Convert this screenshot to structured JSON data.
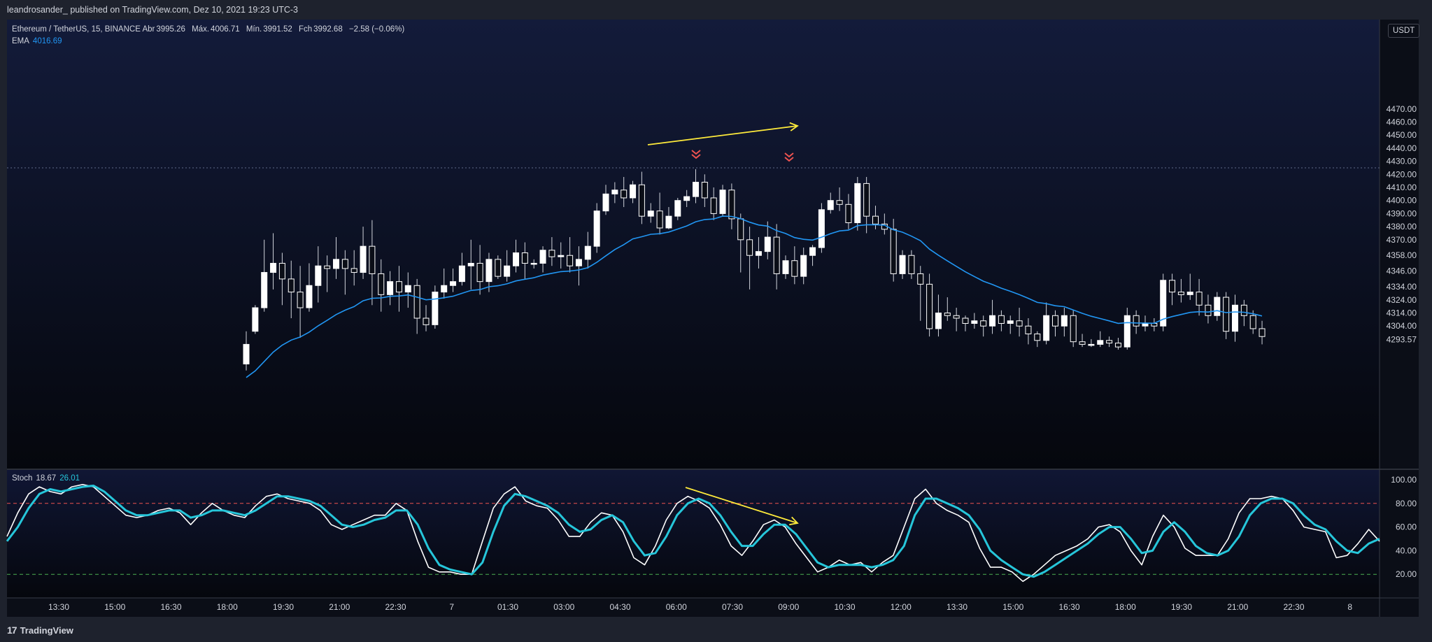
{
  "header": {
    "publish_line": "leandrosander_ published on TradingView.com, Dez 10, 2021 19:23 UTC-3"
  },
  "legend": {
    "symbol": "Ethereum / TetherUS, 15, BINANCE",
    "open_label": "Abr",
    "open": "3995.26",
    "high_label": "Máx.",
    "high": "4006.71",
    "low_label": "Mín.",
    "low": "3991.52",
    "close_label": "Fch",
    "close": "3992.68",
    "change": "−2.58 (−0.06%)",
    "ema_label": "EMA",
    "ema_value": "4016.69"
  },
  "stoch_legend": {
    "label": "Stoch",
    "k": "18.67",
    "d": "26.01"
  },
  "currency_badge": "USDT",
  "footer": {
    "brand": "TradingView",
    "logo_glyph": "17"
  },
  "colors": {
    "ema": "#2196f3",
    "stoch_k": "#ffffff",
    "stoch_d": "#26c6da",
    "upper_band": "#ef5350",
    "lower_band": "#4caf50",
    "annotation": "#ffeb3b",
    "markers": "#ef5350",
    "background": "#0b0e17"
  },
  "chart_data": [
    {
      "type": "candlestick",
      "title": "Ethereum / TetherUS, 15, BINANCE",
      "ylim": [
        4288,
        4480
      ],
      "yticks": [
        4293.57,
        4304.0,
        4314.0,
        4324.0,
        4334.0,
        4346.0,
        4358.0,
        4370.0,
        4380.0,
        4390.0,
        4400.0,
        4410.0,
        4420.0,
        4430.0,
        4440.0,
        4450.0,
        4460.0,
        4470.0
      ],
      "xticks": [
        "13:30",
        "15:00",
        "16:30",
        "18:00",
        "19:30",
        "21:00",
        "22:30",
        "7",
        "01:30",
        "03:00",
        "04:30",
        "06:00",
        "07:30",
        "09:00",
        "10:30",
        "12:00",
        "13:30",
        "15:00",
        "16:30",
        "18:00",
        "19:30",
        "21:00",
        "22:30",
        "8"
      ],
      "resistance_level": 4425,
      "candles": [
        [
          4275,
          4290,
          4270,
          4300
        ],
        [
          4300,
          4318,
          4298,
          4320
        ],
        [
          4318,
          4345,
          4315,
          4370
        ],
        [
          4345,
          4352,
          4332,
          4375
        ],
        [
          4352,
          4340,
          4320,
          4360
        ],
        [
          4340,
          4330,
          4310,
          4354
        ],
        [
          4330,
          4318,
          4295,
          4350
        ],
        [
          4318,
          4335,
          4315,
          4352
        ],
        [
          4335,
          4350,
          4322,
          4365
        ],
        [
          4350,
          4348,
          4330,
          4358
        ],
        [
          4348,
          4355,
          4340,
          4372
        ],
        [
          4355,
          4348,
          4328,
          4362
        ],
        [
          4348,
          4345,
          4335,
          4362
        ],
        [
          4345,
          4365,
          4340,
          4380
        ],
        [
          4365,
          4344,
          4320,
          4385
        ],
        [
          4344,
          4328,
          4315,
          4355
        ],
        [
          4328,
          4338,
          4320,
          4346
        ],
        [
          4338,
          4330,
          4315,
          4350
        ],
        [
          4330,
          4335,
          4318,
          4345
        ],
        [
          4335,
          4310,
          4298,
          4340
        ],
        [
          4310,
          4305,
          4300,
          4320
        ],
        [
          4305,
          4330,
          4302,
          4335
        ],
        [
          4330,
          4335,
          4325,
          4348
        ],
        [
          4335,
          4338,
          4330,
          4348
        ],
        [
          4338,
          4350,
          4335,
          4360
        ],
        [
          4350,
          4352,
          4332,
          4370
        ],
        [
          4352,
          4338,
          4328,
          4366
        ],
        [
          4338,
          4355,
          4330,
          4360
        ],
        [
          4355,
          4342,
          4340,
          4358
        ],
        [
          4342,
          4350,
          4338,
          4362
        ],
        [
          4350,
          4360,
          4345,
          4370
        ],
        [
          4360,
          4352,
          4340,
          4368
        ],
        [
          4352,
          4352,
          4348,
          4355
        ],
        [
          4352,
          4362,
          4345,
          4365
        ],
        [
          4362,
          4357,
          4350,
          4372
        ],
        [
          4357,
          4358,
          4348,
          4368
        ],
        [
          4358,
          4350,
          4345,
          4372
        ],
        [
          4350,
          4355,
          4335,
          4365
        ],
        [
          4355,
          4365,
          4348,
          4376
        ],
        [
          4365,
          4392,
          4360,
          4398
        ],
        [
          4392,
          4405,
          4389,
          4412
        ],
        [
          4405,
          4408,
          4398,
          4414
        ],
        [
          4408,
          4402,
          4395,
          4418
        ],
        [
          4402,
          4412,
          4398,
          4415
        ],
        [
          4412,
          4388,
          4382,
          4422
        ],
        [
          4388,
          4392,
          4383,
          4398
        ],
        [
          4392,
          4379,
          4374,
          4406
        ],
        [
          4379,
          4388,
          4378,
          4395
        ],
        [
          4388,
          4400,
          4385,
          4402
        ],
        [
          4400,
          4403,
          4395,
          4408
        ],
        [
          4403,
          4414,
          4398,
          4424
        ],
        [
          4414,
          4402,
          4395,
          4420
        ],
        [
          4402,
          4390,
          4385,
          4410
        ],
        [
          4390,
          4408,
          4388,
          4412
        ],
        [
          4408,
          4386,
          4378,
          4413
        ],
        [
          4386,
          4370,
          4345,
          4390
        ],
        [
          4370,
          4358,
          4332,
          4380
        ],
        [
          4358,
          4361,
          4348,
          4372
        ],
        [
          4361,
          4372,
          4355,
          4384
        ],
        [
          4372,
          4344,
          4332,
          4382
        ],
        [
          4344,
          4354,
          4340,
          4358
        ],
        [
          4354,
          4342,
          4336,
          4365
        ],
        [
          4342,
          4358,
          4336,
          4364
        ],
        [
          4358,
          4364,
          4350,
          4366
        ],
        [
          4364,
          4393,
          4360,
          4398
        ],
        [
          4393,
          4400,
          4390,
          4406
        ],
        [
          4400,
          4397,
          4392,
          4410
        ],
        [
          4397,
          4383,
          4378,
          4405
        ],
        [
          4383,
          4413,
          4377,
          4418
        ],
        [
          4413,
          4388,
          4375,
          4418
        ],
        [
          4388,
          4382,
          4378,
          4396
        ],
        [
          4382,
          4378,
          4374,
          4390
        ],
        [
          4378,
          4344,
          4338,
          4386
        ],
        [
          4344,
          4358,
          4340,
          4362
        ],
        [
          4358,
          4344,
          4340,
          4362
        ],
        [
          4344,
          4336,
          4308,
          4350
        ],
        [
          4336,
          4302,
          4296,
          4344
        ],
        [
          4302,
          4314,
          4296,
          4328
        ],
        [
          4314,
          4312,
          4308,
          4326
        ],
        [
          4312,
          4310,
          4300,
          4318
        ],
        [
          4310,
          4306,
          4300,
          4312
        ],
        [
          4306,
          4308,
          4302,
          4314
        ],
        [
          4308,
          4304,
          4296,
          4312
        ],
        [
          4304,
          4312,
          4298,
          4324
        ],
        [
          4312,
          4306,
          4300,
          4316
        ],
        [
          4306,
          4308,
          4298,
          4312
        ],
        [
          4308,
          4304,
          4296,
          4318
        ],
        [
          4304,
          4298,
          4290,
          4310
        ],
        [
          4298,
          4293,
          4288,
          4300
        ],
        [
          4293,
          4312,
          4290,
          4322
        ],
        [
          4312,
          4304,
          4296,
          4316
        ],
        [
          4304,
          4312,
          4296,
          4318
        ],
        [
          4312,
          4292,
          4288,
          4316
        ],
        [
          4292,
          4290,
          4288,
          4298
        ],
        [
          4290,
          4290,
          4288,
          4294
        ],
        [
          4290,
          4293,
          4288,
          4300
        ],
        [
          4293,
          4291,
          4288,
          4296
        ],
        [
          4291,
          4288,
          4286,
          4295
        ],
        [
          4288,
          4312,
          4286,
          4318
        ],
        [
          4312,
          4304,
          4298,
          4316
        ],
        [
          4304,
          4306,
          4300,
          4312
        ],
        [
          4306,
          4304,
          4300,
          4310
        ],
        [
          4304,
          4339,
          4300,
          4344
        ],
        [
          4339,
          4330,
          4320,
          4344
        ],
        [
          4330,
          4328,
          4322,
          4340
        ],
        [
          4328,
          4330,
          4324,
          4344
        ],
        [
          4330,
          4320,
          4312,
          4340
        ],
        [
          4320,
          4312,
          4306,
          4328
        ],
        [
          4312,
          4326,
          4308,
          4330
        ],
        [
          4326,
          4300,
          4294,
          4330
        ],
        [
          4300,
          4320,
          4292,
          4328
        ],
        [
          4320,
          4312,
          4304,
          4324
        ],
        [
          4312,
          4302,
          4298,
          4316
        ],
        [
          4302,
          4296,
          4290,
          4308
        ]
      ]
    },
    {
      "type": "line",
      "title": "Stoch",
      "ylim": [
        0,
        100
      ],
      "yticks": [
        20.0,
        40.0,
        60.0,
        80.0,
        100.0
      ],
      "bands": {
        "upper": 80,
        "lower": 20
      },
      "series": [
        {
          "name": "K",
          "values": [
            52,
            72,
            88,
            94,
            90,
            88,
            94,
            96,
            94,
            86,
            78,
            70,
            68,
            70,
            74,
            76,
            72,
            62,
            72,
            80,
            74,
            70,
            68,
            78,
            86,
            88,
            84,
            82,
            80,
            74,
            62,
            58,
            62,
            66,
            70,
            70,
            80,
            74,
            48,
            26,
            22,
            22,
            20,
            20,
            48,
            76,
            88,
            94,
            82,
            78,
            76,
            66,
            52,
            52,
            64,
            72,
            70,
            56,
            34,
            28,
            44,
            66,
            80,
            86,
            82,
            76,
            62,
            44,
            36,
            48,
            62,
            66,
            60,
            46,
            34,
            22,
            26,
            32,
            28,
            30,
            22,
            30,
            36,
            60,
            84,
            92,
            80,
            74,
            70,
            64,
            42,
            26,
            26,
            22,
            14,
            20,
            28,
            36,
            40,
            44,
            50,
            60,
            62,
            56,
            40,
            28,
            52,
            70,
            60,
            42,
            36,
            36,
            36,
            50,
            72,
            84,
            84,
            86,
            84,
            74,
            60,
            58,
            56,
            34,
            36,
            46,
            58,
            48
          ]
        },
        {
          "name": "D",
          "values": [
            48,
            60,
            76,
            88,
            92,
            90,
            92,
            94,
            95,
            90,
            82,
            74,
            70,
            70,
            72,
            74,
            74,
            68,
            70,
            74,
            74,
            72,
            70,
            74,
            80,
            86,
            86,
            84,
            82,
            78,
            70,
            62,
            60,
            62,
            66,
            68,
            74,
            74,
            62,
            42,
            28,
            24,
            22,
            20,
            30,
            56,
            78,
            88,
            86,
            82,
            78,
            72,
            62,
            56,
            58,
            66,
            70,
            64,
            48,
            36,
            38,
            52,
            70,
            80,
            84,
            80,
            70,
            56,
            44,
            44,
            54,
            62,
            62,
            54,
            42,
            30,
            26,
            28,
            28,
            28,
            26,
            28,
            32,
            44,
            70,
            84,
            84,
            80,
            76,
            70,
            58,
            40,
            32,
            26,
            20,
            18,
            22,
            28,
            34,
            40,
            46,
            54,
            60,
            60,
            50,
            38,
            40,
            56,
            64,
            56,
            44,
            38,
            36,
            40,
            52,
            70,
            80,
            84,
            84,
            80,
            70,
            62,
            58,
            48,
            40,
            38,
            46,
            50
          ]
        }
      ]
    }
  ]
}
